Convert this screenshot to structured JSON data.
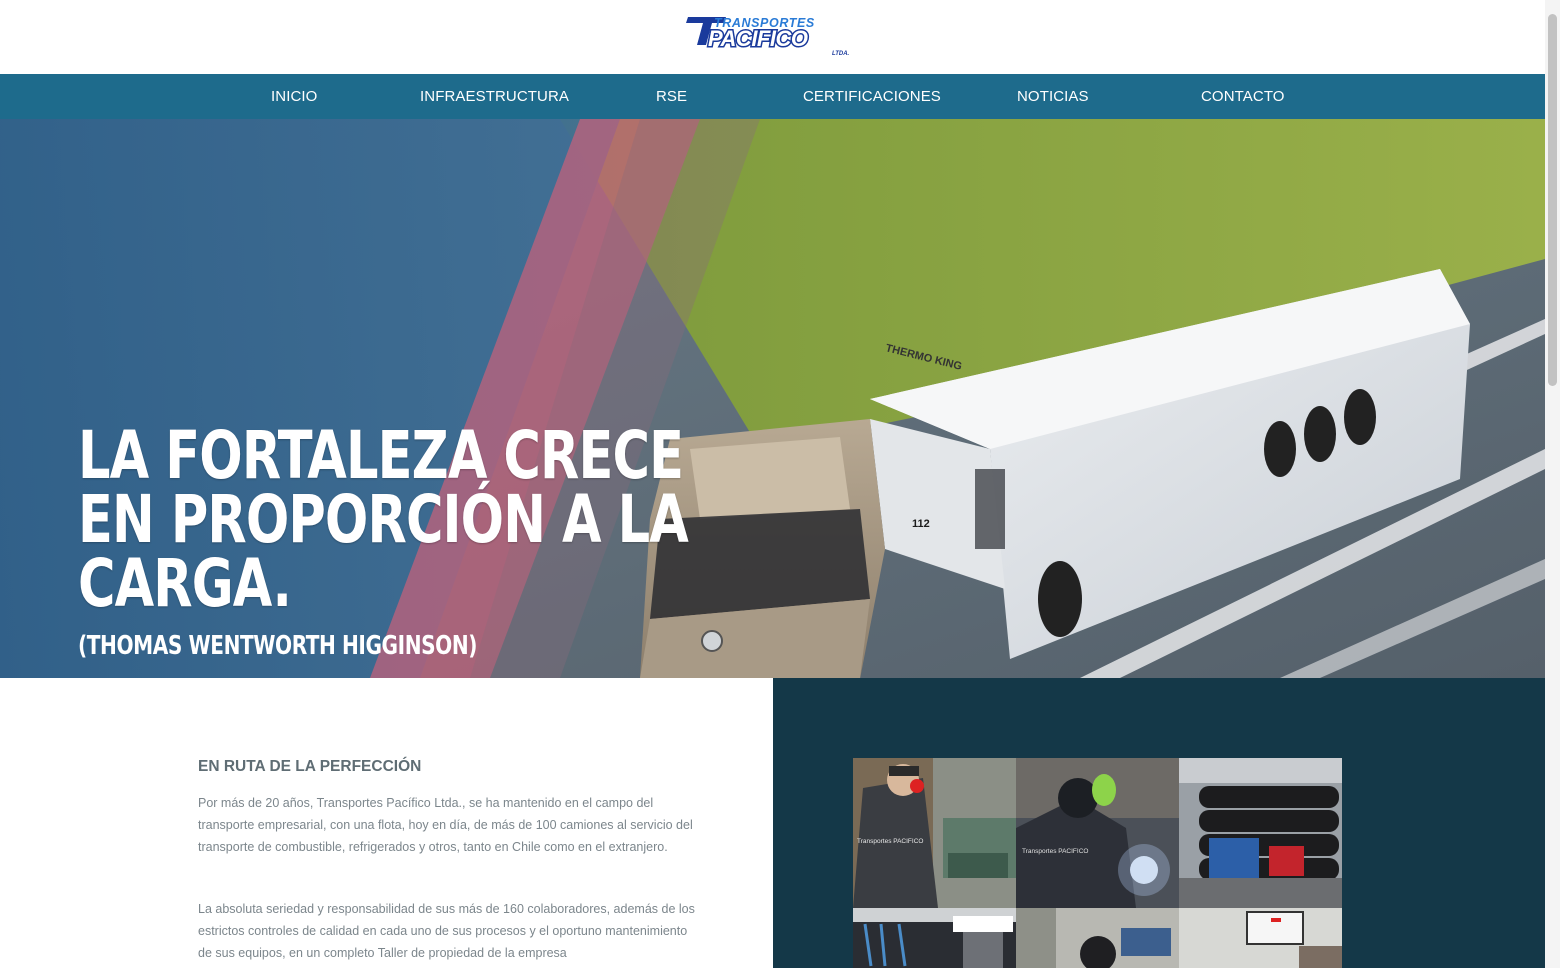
{
  "brand": {
    "logo_top": "TRANSPORTES",
    "logo_main": "PACIFICO",
    "logo_sub": "LTDA."
  },
  "nav": {
    "items": [
      {
        "label": "INICIO"
      },
      {
        "label": "INFRAESTRUCTURA"
      },
      {
        "label": "RSE"
      },
      {
        "label": "CERTIFICACIONES"
      },
      {
        "label": "NOTICIAS"
      },
      {
        "label": "CONTACTO"
      }
    ]
  },
  "hero": {
    "quote_lines": [
      "LA FORTALEZA CRECE",
      "EN PROPORCIÓN A LA",
      "CARGA."
    ],
    "author": "(THOMAS WENTWORTH HIGGINSON)",
    "trailer_text": "THERMO KING",
    "cab_number": "112"
  },
  "about": {
    "title": "EN RUTA DE LA PERFECCIÓN",
    "paragraph1": "Por más de 20 años, Transportes Pacífico Ltda., se ha mantenido en el campo del transporte empresarial, con una flota, hoy en día, de más de 100 camiones al servicio del transporte de combustible, refrigerados y otros, tanto en Chile como en el extranjero.",
    "paragraph2": "La absoluta seriedad y responsabilidad de sus más de 160 colaboradores, además de los estrictos controles de calidad en cada uno de sus procesos y el oportuno mantenimiento de sus equipos, en un completo Taller de propiedad de la empresa"
  },
  "gallery": {
    "photos": [
      {
        "name": "workshop-lathe-photo",
        "jacket_text": "Transportes PACIFICO"
      },
      {
        "name": "welding-photo",
        "jacket_text": "Transportes PACIFICO"
      },
      {
        "name": "tire-storage-photo"
      },
      {
        "name": "tools-wall-photo"
      },
      {
        "name": "office-photo"
      },
      {
        "name": "meeting-screen-photo"
      }
    ]
  },
  "colors": {
    "nav_bg": "#1e6b8c",
    "panel_bg": "#143848",
    "logo_blue": "#1a5ec9"
  }
}
